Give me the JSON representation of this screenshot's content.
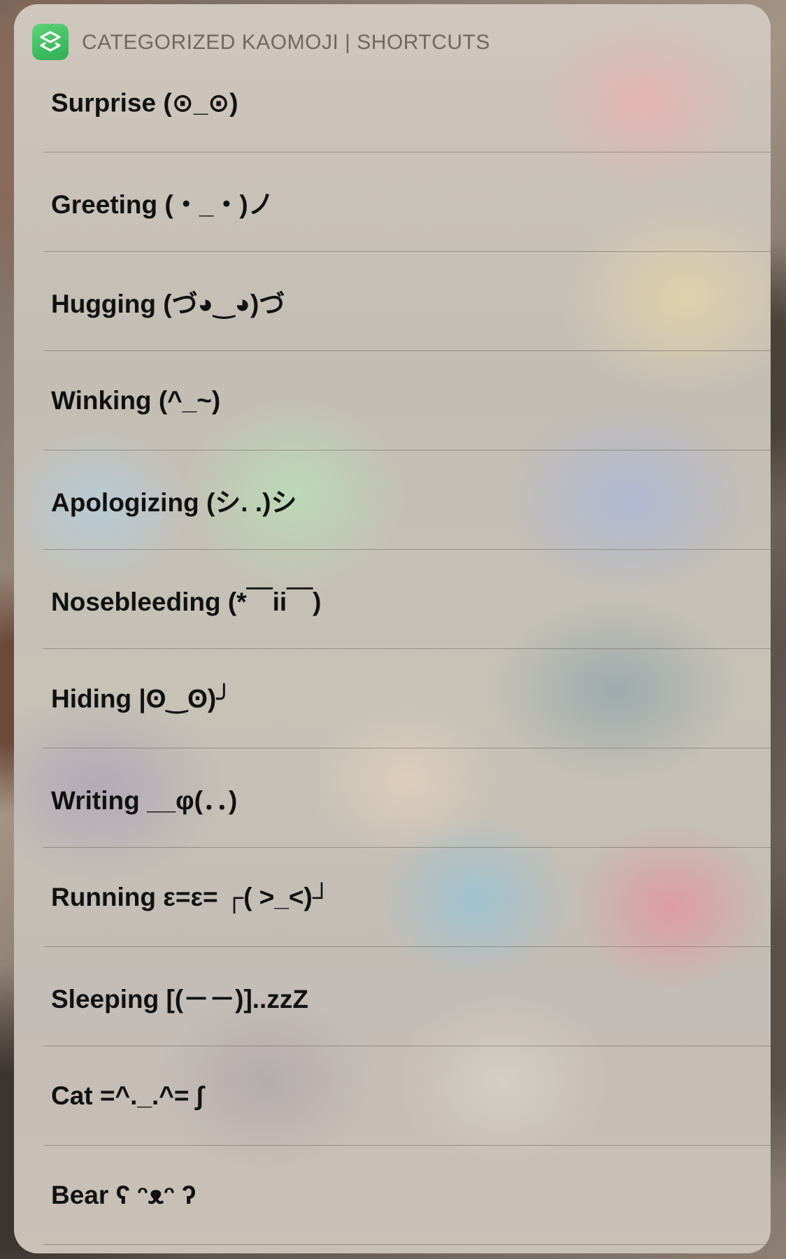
{
  "header": {
    "app_icon": "shortcuts-icon",
    "title": "CATEGORIZED KAOMOJI | SHORTCUTS"
  },
  "items": [
    {
      "label": "Surprise (⊙_⊙)"
    },
    {
      "label": "Greeting (・_・)ノ"
    },
    {
      "label": "Hugging (づ◕‿◕)づ"
    },
    {
      "label": "Winking (^_~)"
    },
    {
      "label": "Apologizing (シ. .)シ"
    },
    {
      "label": "Nosebleeding (*￣ii￣)"
    },
    {
      "label": "Hiding |ʘ‿ʘ)╯"
    },
    {
      "label": "Writing __φ(．．)"
    },
    {
      "label": "Running ε=ε= ┌( >_<)┘"
    },
    {
      "label": "Sleeping [(－－)]..zzZ"
    },
    {
      "label": "Cat =^._.^= ∫"
    },
    {
      "label": "Bear ʕ ᵔᴥᵔ ʔ"
    }
  ],
  "colors": {
    "app_icon_green": "#34c759",
    "title_gray": "#6f6862",
    "label_black": "#111111"
  }
}
